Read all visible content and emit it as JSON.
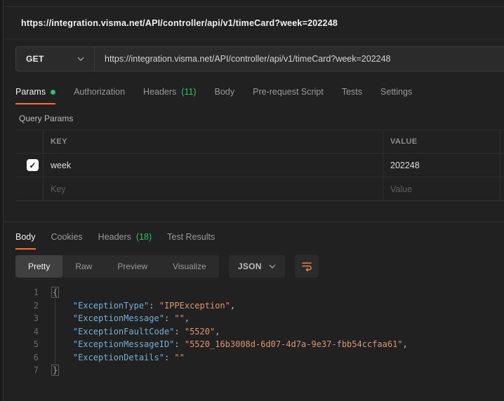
{
  "colors": {
    "accent_orange": "#ff6c37",
    "green": "#2fbe72",
    "code_key_blue": "#74aed6",
    "code_value_orange": "#dd9572",
    "background": "#212121"
  },
  "icons": {
    "check": "✓",
    "chevron_down": "chevron-down",
    "text_wrap": "text-wrap"
  },
  "title": {
    "request_url": "https://integration.visma.net/API/controller/api/v1/timeCard?week=202248"
  },
  "request": {
    "method": "GET",
    "url": "https://integration.visma.net/API/controller/api/v1/timeCard?week=202248",
    "tabs": [
      {
        "label": "Params"
      },
      {
        "label": "Authorization"
      },
      {
        "label": "Headers",
        "count": "(11)"
      },
      {
        "label": "Body"
      },
      {
        "label": "Pre-request Script"
      },
      {
        "label": "Tests"
      },
      {
        "label": "Settings"
      }
    ],
    "query_params": {
      "section_label": "Query Params",
      "columns": {
        "key": "KEY",
        "value": "VALUE"
      },
      "rows": [
        {
          "checked": true,
          "key": "week",
          "value": "202248"
        }
      ],
      "new_row_placeholders": {
        "key": "Key",
        "value": "Value"
      }
    }
  },
  "response": {
    "tabs": [
      {
        "label": "Body"
      },
      {
        "label": "Cookies"
      },
      {
        "label": "Headers",
        "count": "(18)"
      },
      {
        "label": "Test Results"
      }
    ],
    "toolbar": {
      "views": {
        "pretty": "Pretty",
        "raw": "Raw",
        "preview": "Preview",
        "visualize": "Visualize"
      },
      "active_view": "Pretty",
      "format": "JSON"
    },
    "code": {
      "lines": [
        {
          "n": "1",
          "brace": "{"
        },
        {
          "n": "2",
          "indent": "    ",
          "key": "\"ExceptionType\"",
          "sep": ": ",
          "val": "\"IPPException\"",
          "end": ","
        },
        {
          "n": "3",
          "indent": "    ",
          "key": "\"ExceptionMessage\"",
          "sep": ": ",
          "val": "\"\"",
          "end": ","
        },
        {
          "n": "4",
          "indent": "    ",
          "key": "\"ExceptionFaultCode\"",
          "sep": ": ",
          "val": "\"5520\"",
          "end": ","
        },
        {
          "n": "5",
          "indent": "    ",
          "key": "\"ExceptionMessageID\"",
          "sep": ": ",
          "val": "\"5520_16b3008d-6d07-4d7a-9e37-fbb54ccfaa61\"",
          "end": ","
        },
        {
          "n": "6",
          "indent": "    ",
          "key": "\"ExceptionDetails\"",
          "sep": ": ",
          "val": "\"\"",
          "end": ""
        },
        {
          "n": "7",
          "brace": "}"
        }
      ]
    }
  }
}
